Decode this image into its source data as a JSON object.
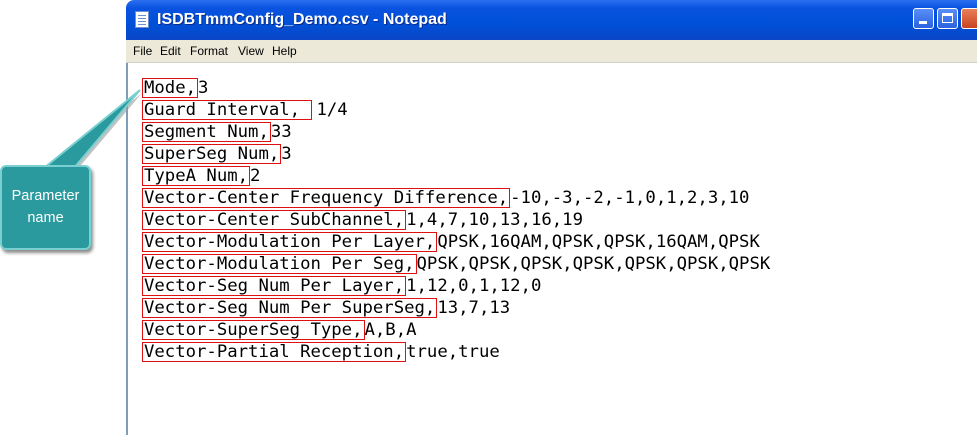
{
  "window": {
    "title": "ISDBTmmConfig_Demo.csv - Notepad"
  },
  "menu": [
    {
      "label": "File"
    },
    {
      "label": "Edit"
    },
    {
      "label": "Format"
    },
    {
      "label": "View"
    },
    {
      "label": "Help"
    }
  ],
  "lines": [
    {
      "name": "Mode,",
      "value": "3"
    },
    {
      "name": "Guard Interval, ",
      "value": "1/4"
    },
    {
      "name": "Segment Num,",
      "value": "33"
    },
    {
      "name": "SuperSeg Num,",
      "value": "3"
    },
    {
      "name": "TypeA Num,",
      "value": "2"
    },
    {
      "name": "Vector-Center Frequency Difference,",
      "value": "-10,-3,-2,-1,0,1,2,3,10"
    },
    {
      "name": "Vector-Center SubChannel,",
      "value": "1,4,7,10,13,16,19"
    },
    {
      "name": "Vector-Modulation Per Layer,",
      "value": "QPSK,16QAM,QPSK,QPSK,16QAM,QPSK"
    },
    {
      "name": "Vector-Modulation Per Seg,",
      "value": "QPSK,QPSK,QPSK,QPSK,QPSK,QPSK,QPSK"
    },
    {
      "name": "Vector-Seg Num Per Layer,",
      "value": "1,12,0,1,12,0"
    },
    {
      "name": "Vector-Seg Num Per SuperSeg,",
      "value": "13,7,13"
    },
    {
      "name": "Vector-SuperSeg Type,",
      "value": "A,B,A"
    },
    {
      "name": "Vector-Partial Reception,",
      "value": "true,true"
    }
  ],
  "callout": {
    "text": "Parameter\nname"
  },
  "colors": {
    "titlebar": "#0050d8",
    "highlight_box": "#e01010",
    "callout_fill": "#2a9a9e"
  }
}
